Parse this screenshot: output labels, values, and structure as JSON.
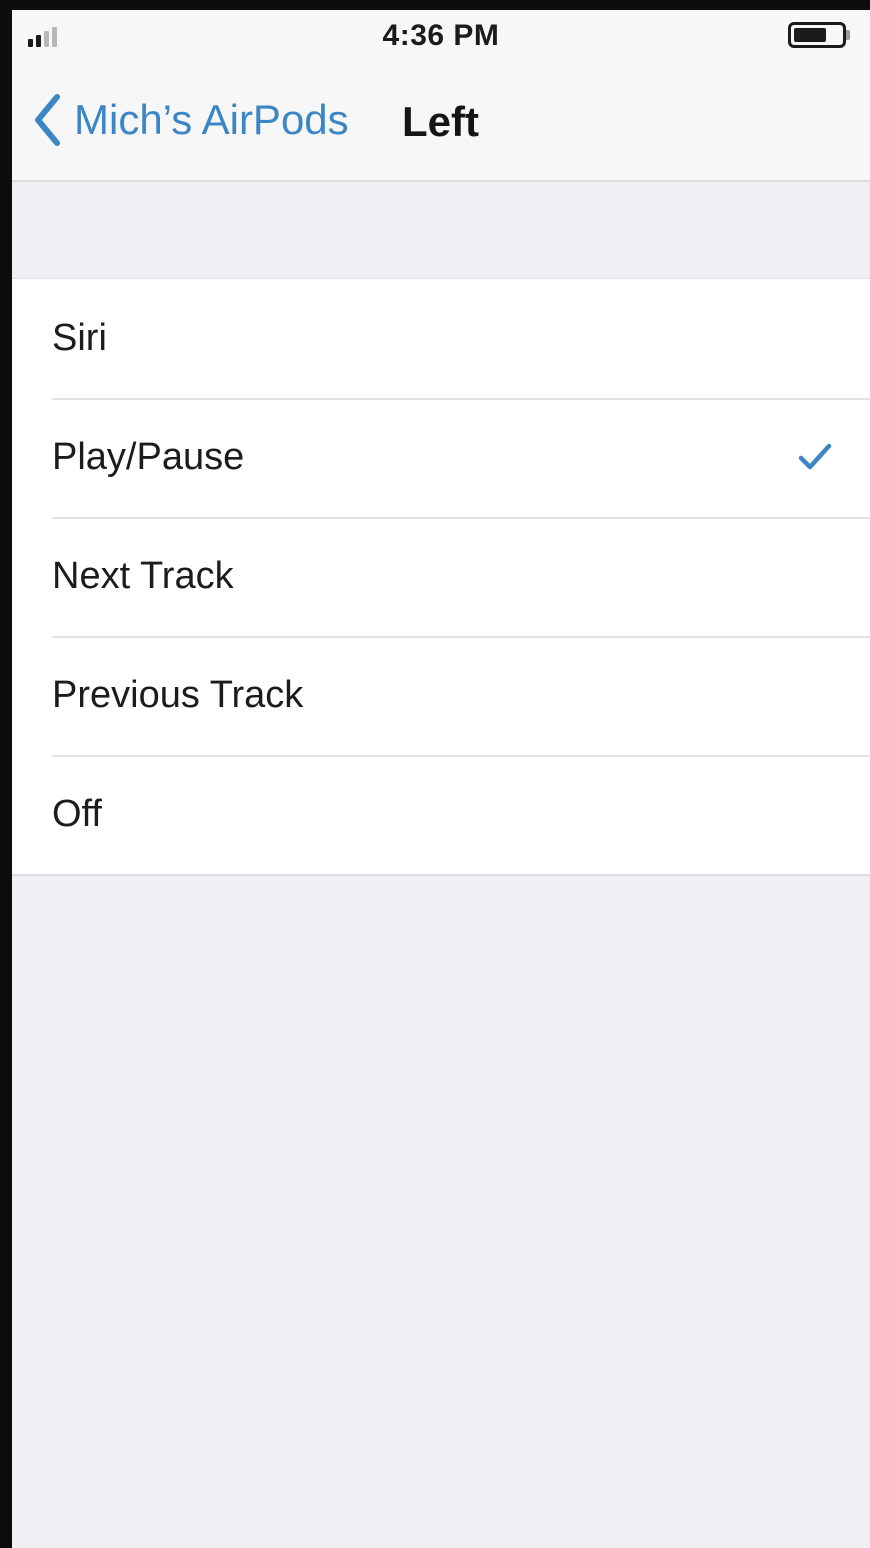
{
  "status_bar": {
    "time": "4:36 PM",
    "signal_icon": "signal-bars-icon",
    "battery_icon": "battery-icon"
  },
  "nav": {
    "back_label": "Mich’s AirPods",
    "back_icon": "chevron-left-icon",
    "title": "Left"
  },
  "options": [
    {
      "label": "Siri",
      "selected": false
    },
    {
      "label": "Play/Pause",
      "selected": true
    },
    {
      "label": "Next Track",
      "selected": false
    },
    {
      "label": "Previous Track",
      "selected": false
    },
    {
      "label": "Off",
      "selected": false
    }
  ],
  "colors": {
    "accent": "#3d86c6",
    "background": "#efeff4",
    "cell": "#ffffff"
  }
}
